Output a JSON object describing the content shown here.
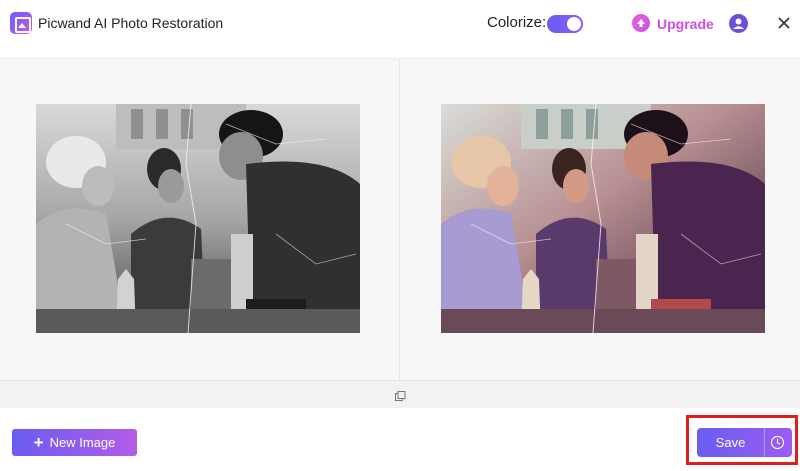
{
  "app": {
    "title": "Picwand AI Photo Restoration"
  },
  "header": {
    "colorize_label": "Colorize:",
    "colorize_enabled": true,
    "upgrade_label": "Upgrade"
  },
  "icons": {
    "logo": "picture-icon",
    "upgrade": "arrow-up-circle-icon",
    "account": "user-icon",
    "close": "close-icon",
    "compare": "compare-icon",
    "add": "plus-icon",
    "history": "clock-icon"
  },
  "colors": {
    "accent": "#6a5cf0",
    "accent_pink": "#cc4fe4",
    "highlight": "#e31c1c"
  },
  "images": {
    "before_label": "original-black-and-white-photo",
    "after_label": "colorized-restored-photo"
  },
  "footer": {
    "new_image_plus": "+",
    "new_image_label": "New Image",
    "save_label": "Save"
  }
}
